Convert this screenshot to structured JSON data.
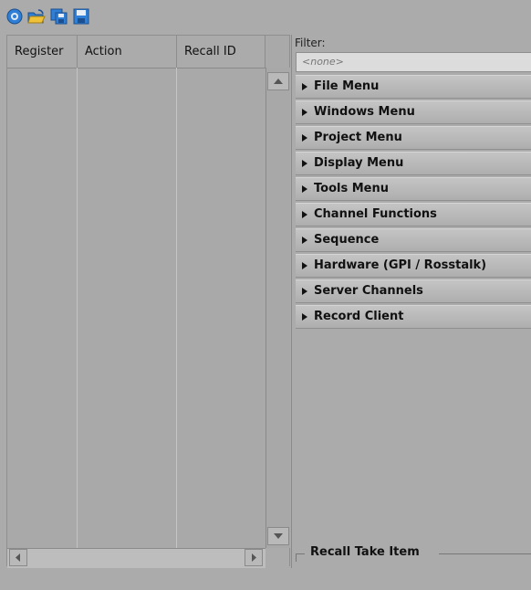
{
  "toolbar": {
    "icons": [
      "settings-icon",
      "open-folder-icon",
      "save-all-icon",
      "save-icon"
    ]
  },
  "table": {
    "columns": [
      "Register",
      "Action",
      "Recall ID"
    ]
  },
  "filter": {
    "label": "Filter:",
    "placeholder": "<none>"
  },
  "menus": [
    {
      "label": "File Menu"
    },
    {
      "label": "Windows Menu"
    },
    {
      "label": "Project Menu"
    },
    {
      "label": "Display Menu"
    },
    {
      "label": "Tools Menu"
    },
    {
      "label": "Channel Functions"
    },
    {
      "label": "Sequence"
    },
    {
      "label": "Hardware (GPI / Rosstalk)"
    },
    {
      "label": "Server Channels"
    },
    {
      "label": "Record Client"
    }
  ],
  "recall_section": {
    "label": "Recall Take Item"
  }
}
